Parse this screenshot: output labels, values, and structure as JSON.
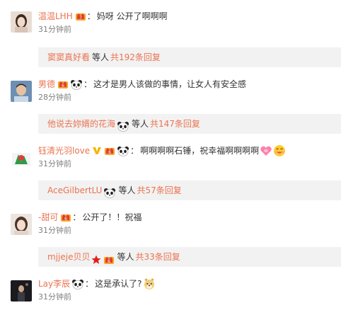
{
  "comments": [
    {
      "user": "温温LHH",
      "text": "妈呀 公开了啊啊啊",
      "time": "31分钟前",
      "reply": {
        "user": "窦窦真好看",
        "mid": "等人",
        "count": "共192条回复"
      }
    },
    {
      "user": "男德",
      "text": "这才是男人该做的事情，让女人有安全感",
      "time": "28分钟前",
      "reply": {
        "user": "他说去妳婿的花海",
        "mid": "等人",
        "count": "共147条回复"
      }
    },
    {
      "user": "钰清光羽love",
      "text": "啊啊啊啊石锤，祝幸福啊啊啊啊",
      "time": "31分钟前",
      "reply": {
        "user": "AceGilbertLU",
        "mid": "等人",
        "count": "共57条回复"
      }
    },
    {
      "user": "-甜可",
      "text": "公开了！！祝福",
      "time": "31分钟前",
      "reply": {
        "user": "mjjeje贝贝",
        "mid": "等人",
        "count": "共33条回复"
      }
    },
    {
      "user": "Lay李辰",
      "text": "这是承认了?",
      "time": "31分钟前"
    }
  ],
  "colors": {
    "username": "#eb7350",
    "text": "#333333",
    "time": "#808080",
    "reply_bg": "#f2f2f2"
  }
}
